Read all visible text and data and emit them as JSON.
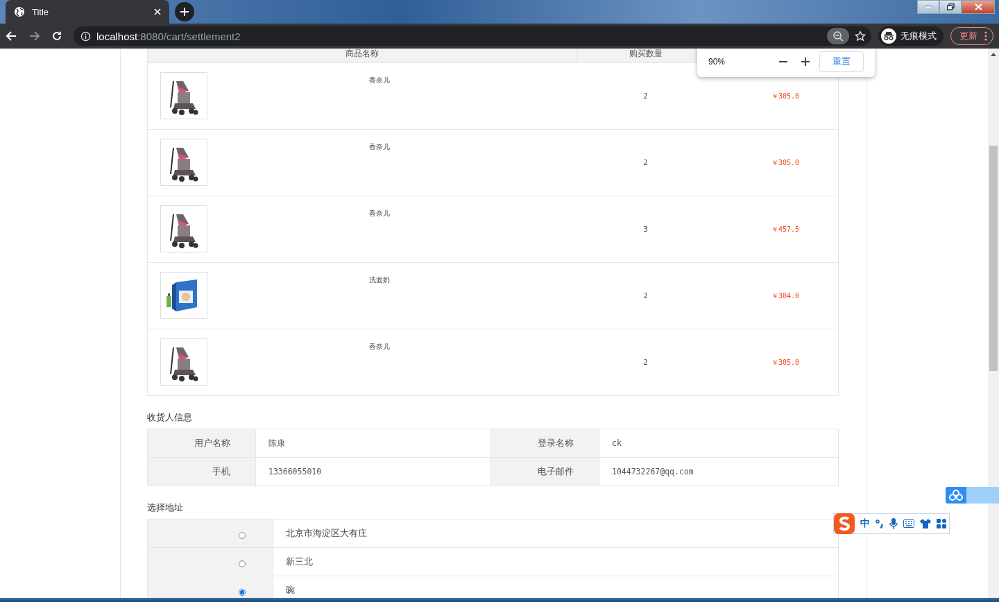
{
  "browser": {
    "tab_title": "Title",
    "url_host": "localhost",
    "url_path": ":8080/cart/settlement2",
    "incognito_label": "无痕模式",
    "update_button": "更新"
  },
  "zoom_popup": {
    "level": "90%",
    "reset_button": "重置"
  },
  "cart": {
    "columns": [
      "商品名称",
      "购买数量"
    ],
    "rows": [
      {
        "kind": "stroller",
        "name": "香奈儿",
        "quantity": "2",
        "price": "￥305.0"
      },
      {
        "kind": "stroller",
        "name": "香奈儿",
        "quantity": "2",
        "price": "￥305.0"
      },
      {
        "kind": "stroller",
        "name": "香奈儿",
        "quantity": "3",
        "price": "￥457.5"
      },
      {
        "kind": "package",
        "name": "洗面奶",
        "quantity": "2",
        "price": "￥304.0"
      },
      {
        "kind": "stroller",
        "name": "香奈儿",
        "quantity": "2",
        "price": "￥305.0"
      }
    ]
  },
  "receiver": {
    "title": "收货人信息",
    "fields": [
      {
        "label": "用户名称",
        "value": "陈康"
      },
      {
        "label": "登录名称",
        "value": "ck"
      },
      {
        "label": "手机",
        "value": "13366055010"
      },
      {
        "label": "电子邮件",
        "value": "1044732267@qq.com"
      }
    ]
  },
  "address": {
    "title": "选择地址",
    "options": [
      {
        "text": "北京市海淀区大有庄",
        "selected": false
      },
      {
        "text": "新三北",
        "selected": false
      },
      {
        "text": "豌",
        "selected": true
      }
    ]
  },
  "ime": {
    "mode": "中"
  }
}
